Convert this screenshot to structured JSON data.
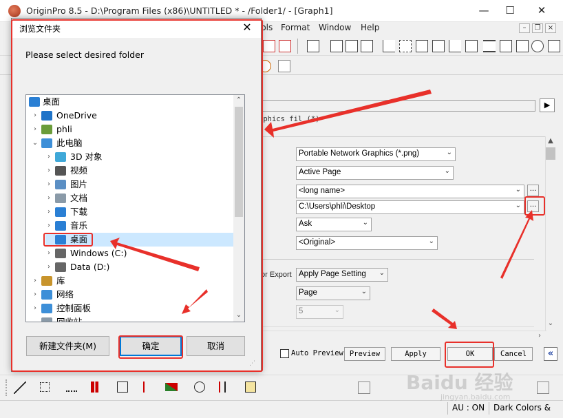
{
  "app": {
    "title": "OriginPro 8.5 - D:\\Program Files (x86)\\UNTITLED * - /Folder1/ - [Graph1]",
    "window_controls": {
      "minimize": "—",
      "maximize": "☐",
      "close": "✕"
    }
  },
  "menu": {
    "items": [
      "ools",
      "Format",
      "Window",
      "Help"
    ],
    "mdi_controls": {
      "minimize": "–",
      "restore": "❐",
      "close": "×"
    }
  },
  "export_dialog": {
    "description_text": "aphics fil (*)",
    "nav_arrow": "▶",
    "fields": {
      "image_type": "Portable Network Graphics (*.png)",
      "export_what": "Active Page",
      "file_name": "<long name>",
      "path": "C:\\Users\\phli\\Desktop",
      "overwrite": "Ask",
      "margin": "<Original>",
      "size_label": "for Export",
      "size_mode": "Apply Page Setting",
      "size_unit": "Page",
      "size_value": "5"
    },
    "browse_button": "...",
    "auto_preview_label": "Auto Preview",
    "buttons": {
      "preview": "Preview",
      "apply": "Apply",
      "ok": "OK",
      "cancel": "Cancel"
    },
    "collapse_button": "«"
  },
  "folder_dialog": {
    "title": "浏览文件夹",
    "close": "✕",
    "prompt": "Please select desired folder",
    "tree": [
      {
        "label": "桌面",
        "icon": "desktop-icon",
        "chevron": "",
        "indent": 0,
        "color": "#2a7fd4"
      },
      {
        "label": "OneDrive",
        "icon": "cloud-icon",
        "chevron": "›",
        "indent": 1,
        "color": "#1f73c8"
      },
      {
        "label": "phli",
        "icon": "user-icon",
        "chevron": "›",
        "indent": 1,
        "color": "#6a9c3a"
      },
      {
        "label": "此电脑",
        "icon": "computer-icon",
        "chevron": "⌄",
        "indent": 1,
        "color": "#3d8fd8"
      },
      {
        "label": "3D 对象",
        "icon": "cube-icon",
        "chevron": "›",
        "indent": 2,
        "color": "#3fa8d8"
      },
      {
        "label": "视频",
        "icon": "video-icon",
        "chevron": "›",
        "indent": 2,
        "color": "#555555"
      },
      {
        "label": "图片",
        "icon": "picture-icon",
        "chevron": "›",
        "indent": 2,
        "color": "#5b8fc4"
      },
      {
        "label": "文档",
        "icon": "document-icon",
        "chevron": "›",
        "indent": 2,
        "color": "#8a9aa8"
      },
      {
        "label": "下载",
        "icon": "download-icon",
        "chevron": "›",
        "indent": 2,
        "color": "#2a7fd4"
      },
      {
        "label": "音乐",
        "icon": "music-icon",
        "chevron": "›",
        "indent": 2,
        "color": "#2a7fd4"
      },
      {
        "label": "桌面",
        "icon": "desktop-icon",
        "chevron": "",
        "indent": 2,
        "color": "#2a7fd4"
      },
      {
        "label": "Windows (C:)",
        "icon": "drive-icon",
        "chevron": "›",
        "indent": 2,
        "color": "#666666"
      },
      {
        "label": "Data (D:)",
        "icon": "drive-icon",
        "chevron": "›",
        "indent": 2,
        "color": "#666666"
      },
      {
        "label": "库",
        "icon": "library-icon",
        "chevron": "›",
        "indent": 1,
        "color": "#c8942c"
      },
      {
        "label": "网络",
        "icon": "network-icon",
        "chevron": "›",
        "indent": 1,
        "color": "#3d8fd8"
      },
      {
        "label": "控制面板",
        "icon": "control-panel-icon",
        "chevron": "›",
        "indent": 1,
        "color": "#3d8fd8"
      },
      {
        "label": "回收站",
        "icon": "recycle-bin-icon",
        "chevron": "",
        "indent": 1,
        "color": "#8a9aa8"
      }
    ],
    "buttons": {
      "new_folder": "新建文件夹(M)",
      "ok": "确定",
      "cancel": "取消"
    }
  },
  "status": {
    "au": "AU : ON",
    "theme": "Dark Colors &"
  },
  "watermark": {
    "text": "Baidu 经验",
    "url": "jingyan.baidu.com"
  },
  "colors": {
    "annotation": "#e8302a",
    "selection": "#cce8ff"
  }
}
